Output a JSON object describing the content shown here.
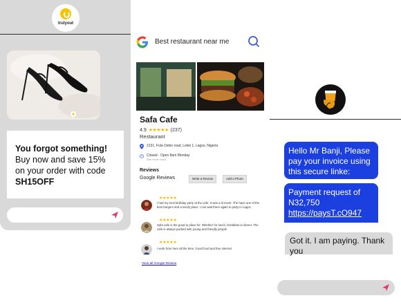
{
  "brand": {
    "name": "trulyout",
    "accent": "#f6c400"
  },
  "promo": {
    "headline": "You forgot something!",
    "line1": "Buy now and save 15%",
    "line2": "on your order with code",
    "code": "SH15OFF"
  },
  "search": {
    "query": "Best restaurant near me"
  },
  "business": {
    "name": "Safa Cafe",
    "rating": "4.9",
    "review_count": "(237)",
    "type": "Restaurant",
    "address": "2131, Fola Osibo road, Lekki 1, Lagos, Nigeria",
    "hours": "Closed · Open 8am Monday",
    "hours_sub": "See more hours"
  },
  "reviews": {
    "title": "Reviews",
    "subtitle": "Google Reviews",
    "write_label": "Write a Review",
    "photo_label": "Add a Photo",
    "items": [
      {
        "stars": "★★★★★",
        "text": "I had my 21st birthday party at the cafe. It was a lit event. The have one of the best burgers and a lovely place. I can wait there again to party in Lagos"
      },
      {
        "stars": "★★★★★",
        "text": "Safa cafe is the good to place for. Whether for lunch, breakfast or dinner. The cafe is always packed with young and friendly people"
      },
      {
        "stars": "★★★★★",
        "text": "I work from here all the time. Good food and free internet"
      }
    ],
    "view_all": "View all Google Review"
  },
  "chat": {
    "msg1": "Hello Mr Banji, Please pay your invoice using this secure linke:",
    "msg2_text": "Payment request of N32,750",
    "msg2_link": "https://paysT.cO947",
    "reply": "Got it. I am paying. Thank you"
  },
  "colors": {
    "chat_blue": "#1c3fe0",
    "star_yellow": "#f4b400",
    "send_pink": "#e8336e"
  }
}
